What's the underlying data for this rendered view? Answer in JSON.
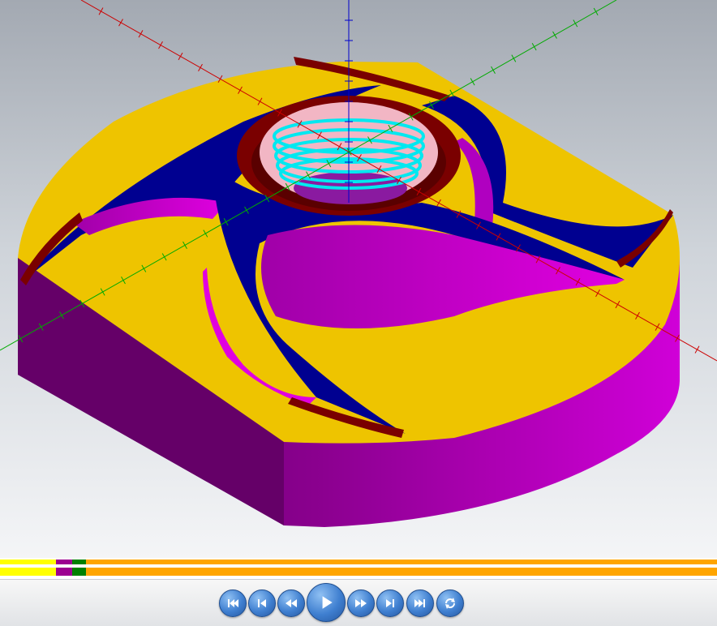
{
  "viewport": {
    "background_top": "#a3a9b2",
    "background_bottom": "#f4f5f7",
    "axes": {
      "x_color": "#cc0000",
      "y_color": "#00aa00",
      "z_color": "#0000cc"
    },
    "part_colors": {
      "top_face": "#eec400",
      "side_wall": "#a000a8",
      "vane": "#000090",
      "vane_wall": "#d000d0",
      "hub_ring": "#7a0000",
      "thread": "#00e8f0",
      "bore": "#f2b6c4"
    }
  },
  "timeline": {
    "track_1": [
      {
        "name": "segment-yellow",
        "color": "#ffff00",
        "fraction": 0.078
      },
      {
        "name": "segment-purple",
        "color": "#9c0090",
        "fraction": 0.023
      },
      {
        "name": "segment-green",
        "color": "#008000",
        "fraction": 0.019
      },
      {
        "name": "segment-orange",
        "color": "#ffa500",
        "fraction": 0.88
      }
    ],
    "track_2": [
      {
        "name": "segment-yellow",
        "color": "#ffff00",
        "fraction": 0.078
      },
      {
        "name": "segment-purple",
        "color": "#9c0090",
        "fraction": 0.023
      },
      {
        "name": "segment-green",
        "color": "#008000",
        "fraction": 0.019
      },
      {
        "name": "segment-orange",
        "color": "#ffa500",
        "fraction": 0.88
      }
    ]
  },
  "toolbar": {
    "buttons": [
      {
        "name": "skip-to-start-button",
        "icon": "skip-start-icon"
      },
      {
        "name": "step-back-button",
        "icon": "step-back-icon"
      },
      {
        "name": "rewind-button",
        "icon": "rewind-icon"
      },
      {
        "name": "play-button",
        "icon": "play-icon"
      },
      {
        "name": "fast-forward-button",
        "icon": "fast-forward-icon"
      },
      {
        "name": "step-forward-button",
        "icon": "step-forward-icon"
      },
      {
        "name": "skip-to-end-button",
        "icon": "skip-end-icon"
      },
      {
        "name": "loop-button",
        "icon": "loop-icon"
      }
    ]
  }
}
